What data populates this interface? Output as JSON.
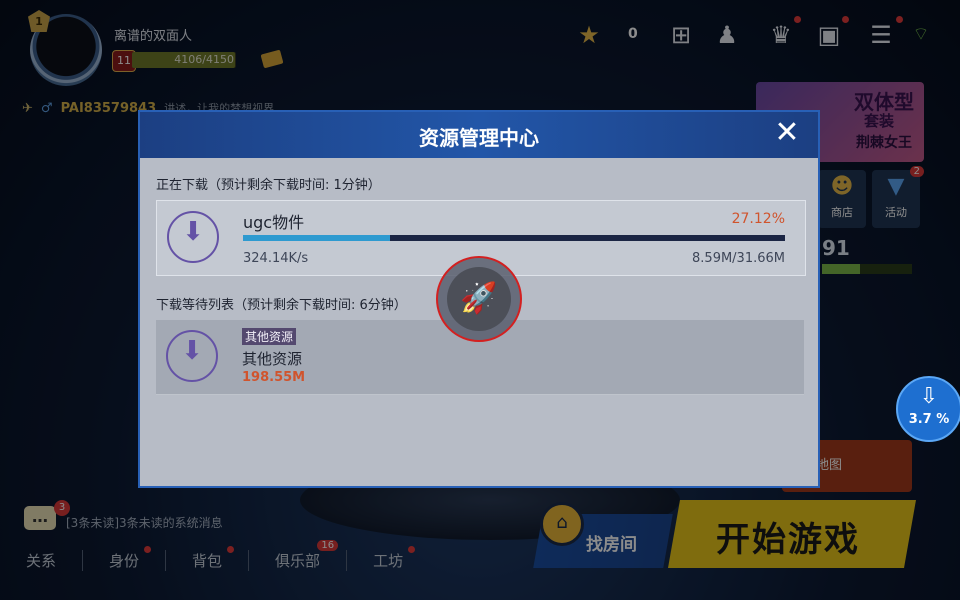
{
  "player": {
    "level_shield": "1",
    "name": "离谱的双面人",
    "level": "11",
    "xp": "4106/4150",
    "xp_fraction": 0.99,
    "pid": "PAI83579843",
    "motto": "讲述，让我的梦想视界"
  },
  "topbar": {
    "coin_count": "0",
    "icons": [
      "star-coin-icon",
      "add-icon",
      "add-friend-icon",
      "rank-icon",
      "tv-icon",
      "menu-icon",
      "wifi-icon"
    ]
  },
  "promo": {
    "line1": "双体型",
    "line2": "套装",
    "line3": "荆棘女王"
  },
  "side_buttons": [
    {
      "label": "商店",
      "icon": "shop-icon"
    },
    {
      "label": "活动",
      "icon": "event-icon",
      "badge": "2"
    }
  ],
  "rating": {
    "value": "91",
    "fraction": 0.42
  },
  "download_badge": {
    "percent": "3.7 %"
  },
  "map_tile": {
    "label": "地图"
  },
  "chat": {
    "badge": "3",
    "message": "[3条未读]3条未读的系统消息"
  },
  "bottom_nav": [
    {
      "label": "关系"
    },
    {
      "label": "身份",
      "dot": true
    },
    {
      "label": "背包",
      "dot": true
    },
    {
      "label": "俱乐部",
      "badge": "16"
    },
    {
      "label": "工坊",
      "dot": true
    }
  ],
  "find_room": {
    "label": "找房间"
  },
  "start_game": {
    "label": "开始游戏"
  },
  "modal": {
    "title": "资源管理中心",
    "close": "✕",
    "downloading_title": "正在下载（预计剩余下载时间: 1分钟）",
    "current": {
      "name": "ugc物件",
      "percent_text": "27.12%",
      "progress": 0.2712,
      "speed": "324.14K/s",
      "size": "8.59M/31.66M"
    },
    "queue_title": "下载等待列表（预计剩余下载时间: 6分钟）",
    "queue": [
      {
        "tag": "其他资源",
        "name": "其他资源",
        "size": "198.55M"
      }
    ]
  },
  "colors": {
    "modal_header": "#2256a8",
    "progress_fill": "#2e9ad0",
    "progress_track": "#1b2544",
    "accent_orange": "#d0542d",
    "start_yellow": "#e8c51a",
    "boost_ring": "#d32020"
  }
}
